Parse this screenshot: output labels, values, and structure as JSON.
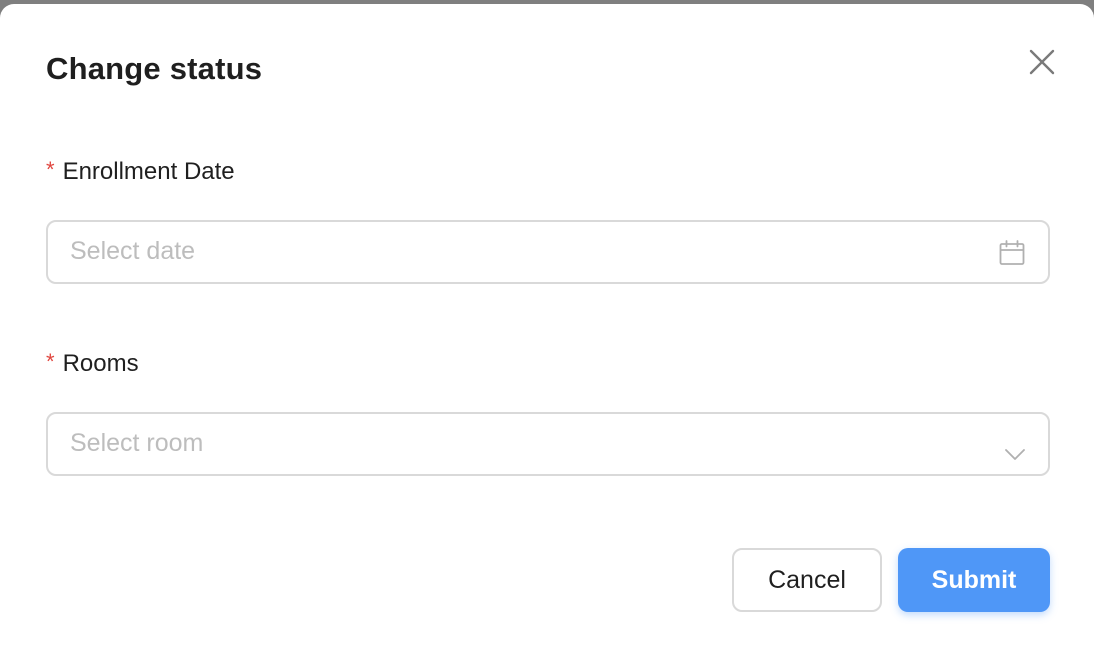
{
  "dialog": {
    "title": "Change status",
    "close_icon": "close-icon"
  },
  "form": {
    "required_marker": "*",
    "enrollment_date": {
      "label": "Enrollment Date",
      "placeholder": "Select date",
      "icon": "calendar-icon"
    },
    "rooms": {
      "label": "Rooms",
      "placeholder": "Select room",
      "icon": "chevron-down-icon"
    }
  },
  "actions": {
    "cancel_label": "Cancel",
    "submit_label": "Submit"
  },
  "colors": {
    "primary": "#4f97f7",
    "required": "#e0463f",
    "border": "#d9d9d9",
    "placeholder": "#bdbdbd",
    "text": "#1f1f1f"
  }
}
